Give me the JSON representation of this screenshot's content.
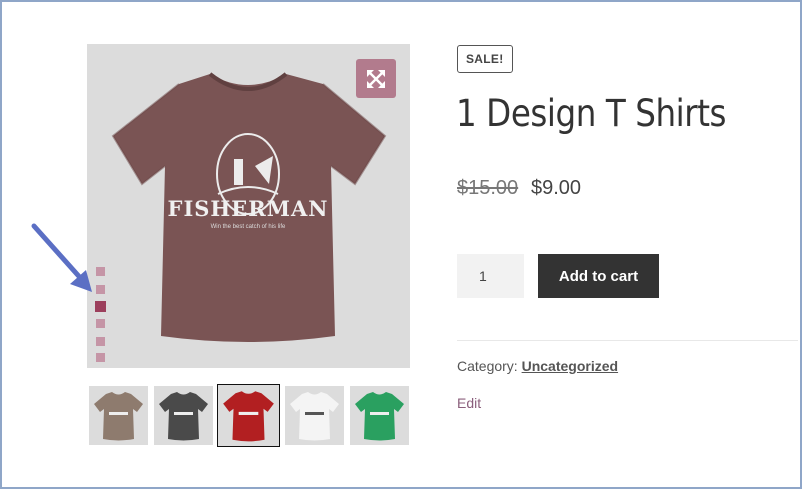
{
  "gallery": {
    "zoom_icon": "expand-arrows-icon",
    "dot_count": 6,
    "active_dot": 2,
    "main_shirt": {
      "color": "#7a5454",
      "brand": "FISHERMAN",
      "tagline": "Win the best catch of his life"
    },
    "thumbnails": [
      {
        "color": "#8e7b6e",
        "label": "FISHERMAN",
        "selected": false
      },
      {
        "color": "#4a4a4a",
        "label": "FISHERMAN",
        "selected": false
      },
      {
        "color": "#b21f21",
        "label": "FISHERMAN",
        "selected": true
      },
      {
        "color": "#f4f4f4",
        "label": "FISHERMAN",
        "selected": false
      },
      {
        "color": "#2aa060",
        "label": "FISHERMAN",
        "selected": false
      }
    ]
  },
  "product": {
    "badge": "SALE!",
    "title": "1 Design T Shirts",
    "old_price": "$15.00",
    "price": "$9.00",
    "quantity": "1",
    "add_to_cart": "Add to cart",
    "category_label": "Category:",
    "category_value": "Uncategorized",
    "edit_label": "Edit"
  },
  "colors": {
    "accent": "#b27b8d",
    "dark_button": "#333333",
    "frame": "#8fa6c8",
    "arrow": "#5b6fc4"
  }
}
